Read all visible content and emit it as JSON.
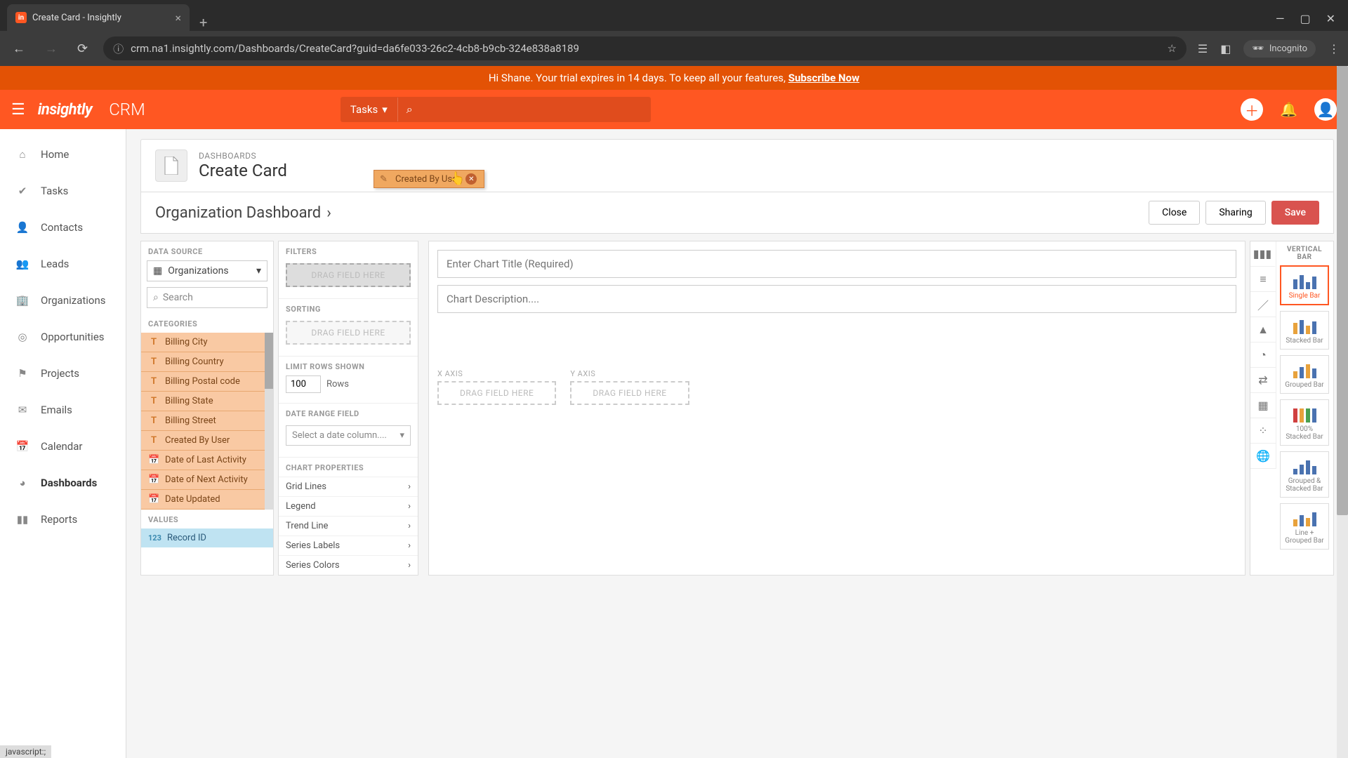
{
  "tab": {
    "title": "Create Card - Insightly"
  },
  "url": "crm.na1.insightly.com/Dashboards/CreateCard?guid=da6fe033-26c2-4cb8-b9cb-324e838a8189",
  "incognito_label": "Incognito",
  "trial": {
    "greeting": "Hi Shane. Your trial expires in 14 days. To keep all your features, ",
    "cta": "Subscribe Now"
  },
  "header": {
    "logo": "insightly",
    "product": "CRM",
    "search_scope": "Tasks"
  },
  "sidebar": {
    "items": [
      {
        "label": "Home",
        "icon": "home"
      },
      {
        "label": "Tasks",
        "icon": "check"
      },
      {
        "label": "Contacts",
        "icon": "person"
      },
      {
        "label": "Leads",
        "icon": "people"
      },
      {
        "label": "Organizations",
        "icon": "building"
      },
      {
        "label": "Opportunities",
        "icon": "target"
      },
      {
        "label": "Projects",
        "icon": "flag"
      },
      {
        "label": "Emails",
        "icon": "mail"
      },
      {
        "label": "Calendar",
        "icon": "calendar"
      },
      {
        "label": "Dashboards",
        "icon": "gauge",
        "active": true
      },
      {
        "label": "Reports",
        "icon": "bars"
      }
    ]
  },
  "page": {
    "breadcrumb": "DASHBOARDS",
    "title": "Create Card",
    "dashboard": "Organization Dashboard"
  },
  "actions": {
    "close": "Close",
    "sharing": "Sharing",
    "save": "Save"
  },
  "datasource": {
    "label": "DATA SOURCE",
    "value": "Organizations",
    "search_placeholder": "Search"
  },
  "categories": {
    "label": "CATEGORIES",
    "items": [
      {
        "label": "Billing City",
        "type": "T"
      },
      {
        "label": "Billing Country",
        "type": "T"
      },
      {
        "label": "Billing Postal code",
        "type": "T"
      },
      {
        "label": "Billing State",
        "type": "T"
      },
      {
        "label": "Billing Street",
        "type": "T"
      },
      {
        "label": "Created By User",
        "type": "T"
      },
      {
        "label": "Date of Last Activity",
        "type": "date"
      },
      {
        "label": "Date of Next Activity",
        "type": "date"
      },
      {
        "label": "Date Updated",
        "type": "date"
      }
    ]
  },
  "values": {
    "label": "VALUES",
    "items": [
      {
        "label": "Record ID",
        "type": "123"
      }
    ]
  },
  "config": {
    "filters_label": "FILTERS",
    "sorting_label": "SORTING",
    "drag_hint": "DRAG FIELD HERE",
    "limit_label": "LIMIT ROWS SHOWN",
    "limit_value": "100",
    "rows_suffix": "Rows",
    "daterange_label": "DATE RANGE FIELD",
    "daterange_placeholder": "Select a date column....",
    "properties_label": "CHART PROPERTIES",
    "properties": [
      "Grid Lines",
      "Legend",
      "Trend Line",
      "Series Labels",
      "Series Colors"
    ]
  },
  "drag": {
    "field": "Created By User"
  },
  "chart": {
    "title_placeholder": "Enter Chart Title (Required)",
    "desc_placeholder": "Chart Description....",
    "xaxis": "X AXIS",
    "yaxis": "Y AXIS"
  },
  "charttypes": {
    "group_label": "VERTICAL BAR",
    "options": [
      "Single Bar",
      "Stacked Bar",
      "Grouped Bar",
      "100% Stacked Bar",
      "Grouped & Stacked Bar",
      "Line + Grouped Bar"
    ]
  },
  "status": "javascript:;"
}
